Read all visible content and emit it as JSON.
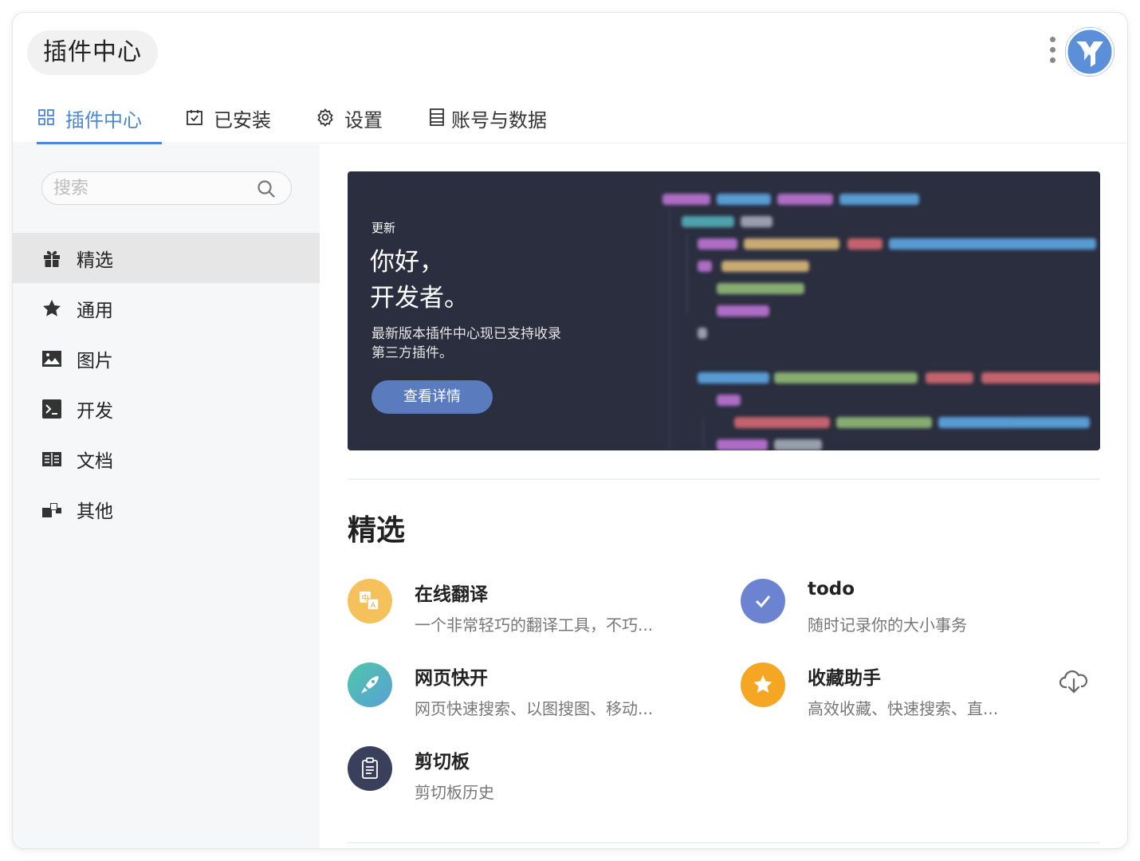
{
  "window": {
    "title": "插件中心"
  },
  "tabs": [
    {
      "label": "插件中心",
      "icon": "grid-icon",
      "active": true
    },
    {
      "label": "已安装",
      "icon": "calendar-check-icon",
      "active": false
    },
    {
      "label": "设置",
      "icon": "gear-icon",
      "active": false
    },
    {
      "label": "账号与数据",
      "icon": "list-icon",
      "active": false
    }
  ],
  "search": {
    "placeholder": "搜索",
    "value": ""
  },
  "sidebar": {
    "items": [
      {
        "label": "精选",
        "icon": "gift-icon",
        "active": true
      },
      {
        "label": "通用",
        "icon": "star-icon",
        "active": false
      },
      {
        "label": "图片",
        "icon": "image-icon",
        "active": false
      },
      {
        "label": "开发",
        "icon": "terminal-icon",
        "active": false
      },
      {
        "label": "文档",
        "icon": "book-icon",
        "active": false
      },
      {
        "label": "其他",
        "icon": "blocks-icon",
        "active": false
      }
    ]
  },
  "banner": {
    "eyebrow": "更新",
    "headline_1": "你好，",
    "headline_2": "开发者。",
    "desc_1": "最新版本插件中心现已支持收录",
    "desc_2": "第三方插件。",
    "cta": "查看详情"
  },
  "section": {
    "title": "精选"
  },
  "plugins": [
    {
      "name": "在线翻译",
      "desc": "一个非常轻巧的翻译工具，不巧...",
      "icon": "translate-icon",
      "color": "#f5c15a"
    },
    {
      "name": "todo",
      "desc": "随时记录你的大小事务",
      "icon": "check-icon",
      "color": "#6b83d1"
    },
    {
      "name": "网页快开",
      "desc": "网页快速搜索、以图搜图、移动...",
      "icon": "rocket-icon",
      "color": "#5cc3b0"
    },
    {
      "name": "收藏助手",
      "desc": "高效收藏、快速搜索、直...",
      "icon": "star-badge-icon",
      "color": "#f5a623"
    },
    {
      "name": "剪切板",
      "desc": "剪切板历史",
      "icon": "clipboard-icon",
      "color": "#3a3f5c"
    }
  ],
  "colors": {
    "accent": "#4a86d8",
    "banner_bg": "#2a2e3f",
    "cta_bg": "#5b7bbf"
  }
}
